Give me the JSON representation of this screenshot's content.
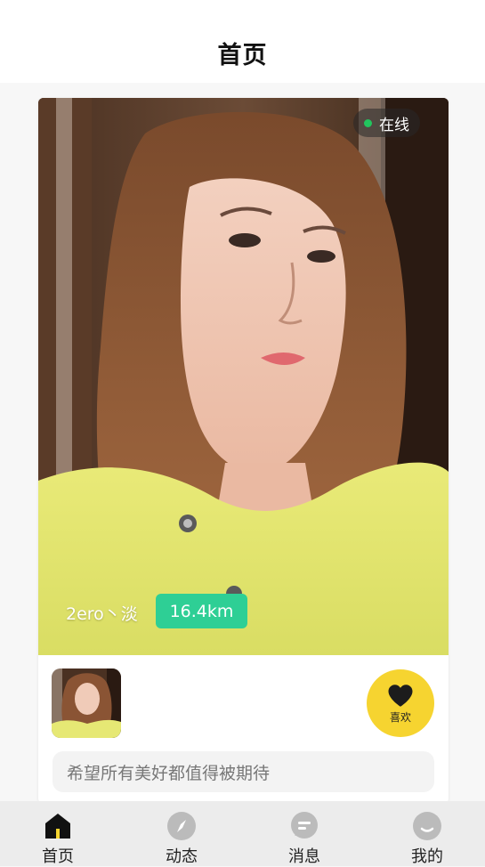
{
  "header": {
    "title": "首页"
  },
  "card": {
    "status": "在线",
    "username": "2ero丶淡",
    "distance": "16.4km",
    "like_label": "喜欢",
    "signature": "希望所有美好都值得被期待"
  },
  "tabbar": {
    "items": [
      {
        "label": "首页",
        "icon": "home-icon",
        "active": true
      },
      {
        "label": "动态",
        "icon": "compass-icon",
        "active": false
      },
      {
        "label": "消息",
        "icon": "message-icon",
        "active": false
      },
      {
        "label": "我的",
        "icon": "profile-icon",
        "active": false
      }
    ]
  },
  "colors": {
    "accent_yellow": "#f6d430",
    "distance_green": "#2ecf95",
    "online_green": "#22c55e",
    "tab_inactive": "#bbbbbb",
    "tab_active": "#111111"
  }
}
